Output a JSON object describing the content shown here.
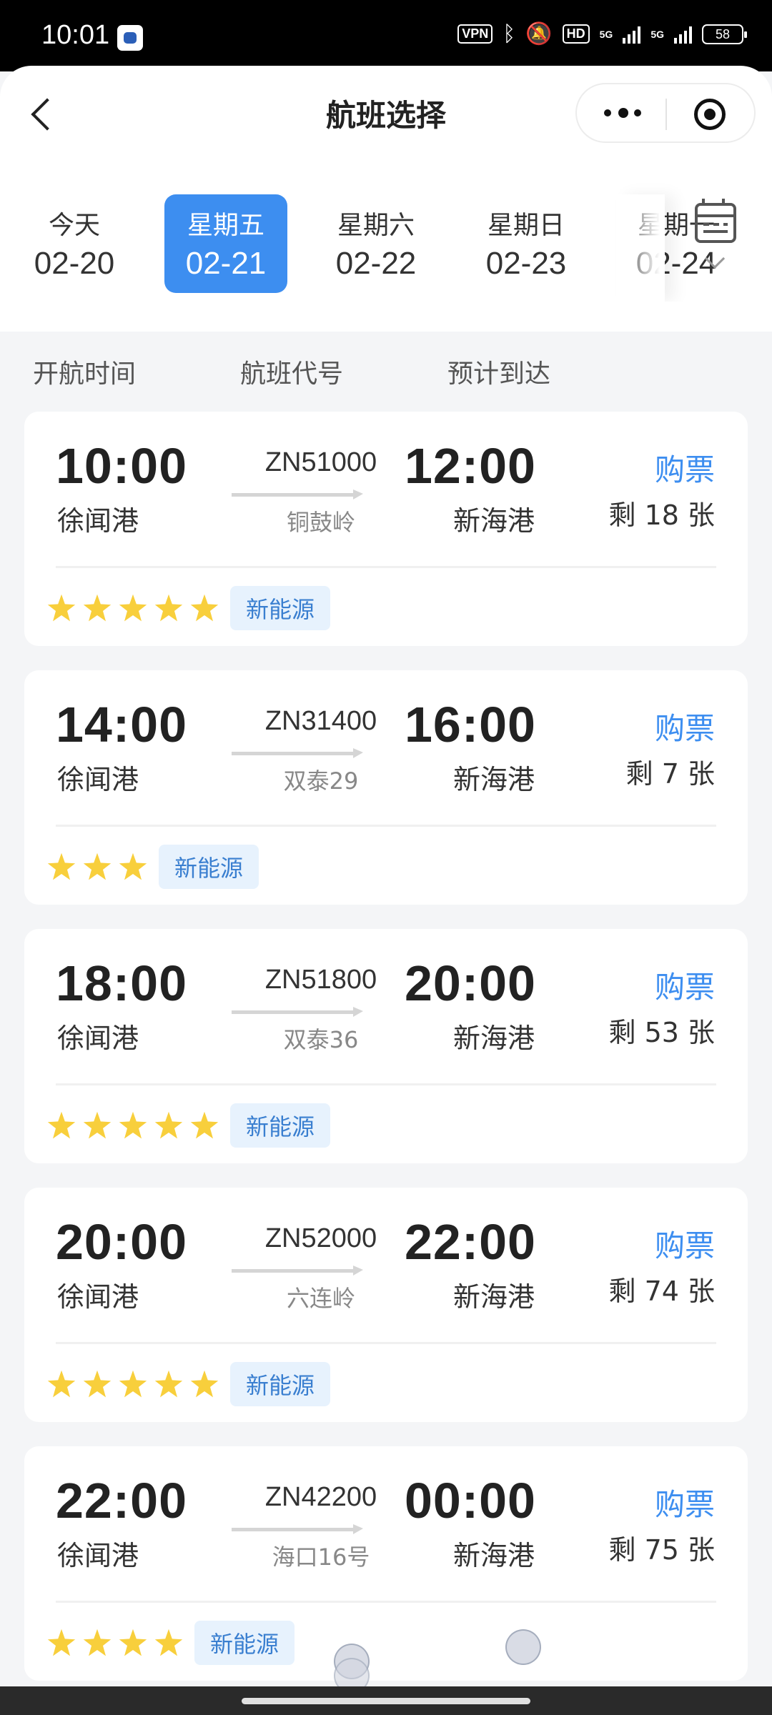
{
  "status_bar": {
    "time": "10:01",
    "vpn": "VPN",
    "hd": "HD",
    "signal_1": "5G",
    "signal_2": "5G",
    "battery": "58"
  },
  "header": {
    "title": "航班选择",
    "back_icon": "back-arrow-icon",
    "more_icon": "more-dots-icon",
    "target_icon": "record-target-icon"
  },
  "dates": [
    {
      "weekday": "今天",
      "date": "02-20",
      "selected": false
    },
    {
      "weekday": "星期五",
      "date": "02-21",
      "selected": true
    },
    {
      "weekday": "星期六",
      "date": "02-22",
      "selected": false
    },
    {
      "weekday": "星期日",
      "date": "02-23",
      "selected": false
    },
    {
      "weekday": "星期一",
      "date": "02-24",
      "selected": false
    }
  ],
  "column_headers": {
    "departure": "开航时间",
    "flight_no": "航班代号",
    "arrival": "预计到达"
  },
  "flights": [
    {
      "dep_time": "10:00",
      "dep_port": "徐闻港",
      "flight_no": "ZN51000",
      "ship": "铜鼓岭",
      "arr_time": "12:00",
      "arr_port": "新海港",
      "buy_label": "购票",
      "seats": "剩 18 张",
      "stars": 5,
      "tag": "新能源"
    },
    {
      "dep_time": "14:00",
      "dep_port": "徐闻港",
      "flight_no": "ZN31400",
      "ship": "双泰29",
      "arr_time": "16:00",
      "arr_port": "新海港",
      "buy_label": "购票",
      "seats": "剩 7 张",
      "stars": 3,
      "tag": "新能源"
    },
    {
      "dep_time": "18:00",
      "dep_port": "徐闻港",
      "flight_no": "ZN51800",
      "ship": "双泰36",
      "arr_time": "20:00",
      "arr_port": "新海港",
      "buy_label": "购票",
      "seats": "剩 53 张",
      "stars": 5,
      "tag": "新能源"
    },
    {
      "dep_time": "20:00",
      "dep_port": "徐闻港",
      "flight_no": "ZN52000",
      "ship": "六连岭",
      "arr_time": "22:00",
      "arr_port": "新海港",
      "buy_label": "购票",
      "seats": "剩 74 张",
      "stars": 5,
      "tag": "新能源"
    },
    {
      "dep_time": "22:00",
      "dep_port": "徐闻港",
      "flight_no": "ZN42200",
      "ship": "海口16号",
      "arr_time": "00:00",
      "arr_port": "新海港",
      "buy_label": "购票",
      "seats": "剩 75 张",
      "stars": 4,
      "tag": "新能源"
    }
  ],
  "colors": {
    "accent": "#3d8ef0",
    "star": "#f8cf3c",
    "tag_bg": "#e7f2fd",
    "page_bg": "#f4f5f7"
  }
}
